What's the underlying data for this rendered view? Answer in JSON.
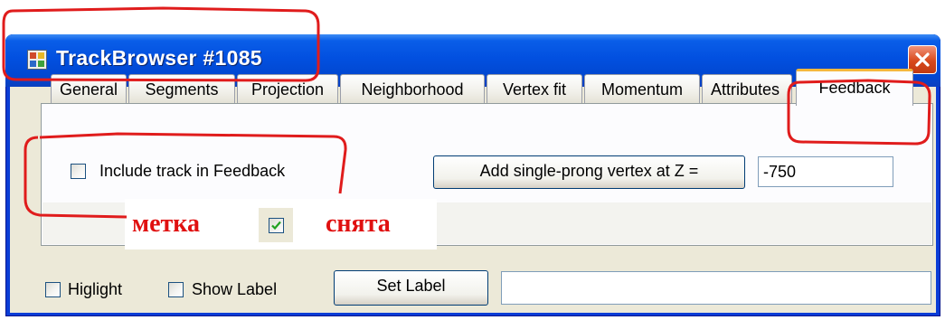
{
  "window": {
    "title": "TrackBrowser #1085",
    "titlebar_color": "#0250e0",
    "close_color": "#d8491c"
  },
  "tabs": [
    {
      "label": "General",
      "active": false
    },
    {
      "label": "Segments",
      "active": false
    },
    {
      "label": "Projection",
      "active": false
    },
    {
      "label": "Neighborhood",
      "active": false
    },
    {
      "label": "Vertex fit",
      "active": false
    },
    {
      "label": "Momentum",
      "active": false
    },
    {
      "label": "Attributes",
      "active": false
    },
    {
      "label": "Feedback",
      "active": true
    }
  ],
  "feedback_panel": {
    "include_checkbox_label": "Include track in Feedback",
    "include_checked": false,
    "add_vertex_button_label": "Add single-prong vertex at Z =",
    "z_value": "-750"
  },
  "bottom_bar": {
    "highlight_label": "Higlight",
    "highlight_checked": false,
    "show_label_label": "Show Label",
    "show_label_checked": false,
    "set_label_button_label": "Set Label",
    "label_value": ""
  },
  "annotation": {
    "word_left": "метка",
    "word_right": "снята",
    "checkbox_checked": true,
    "color": "#e01010"
  }
}
